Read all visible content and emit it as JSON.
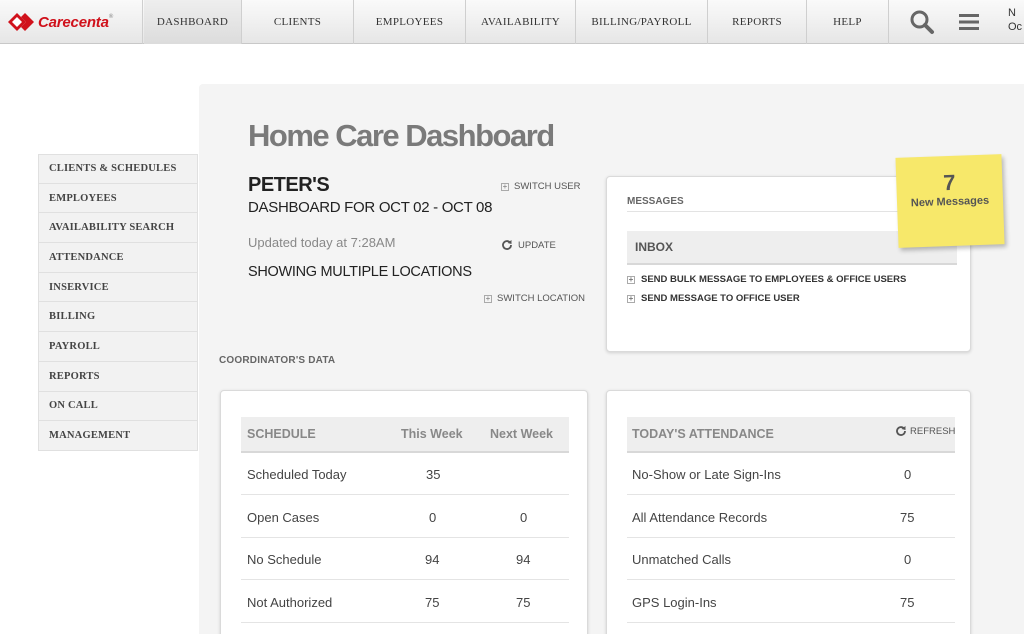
{
  "brand": {
    "name": "Carecenta",
    "reg": "®"
  },
  "nav": {
    "items": [
      "DASHBOARD",
      "CLIENTS",
      "EMPLOYEES",
      "AVAILABILITY",
      "BILLING/PAYROLL",
      "REPORTS",
      "HELP"
    ],
    "active": "DASHBOARD",
    "user_cut_line1": "N",
    "user_cut_line2": "Oc"
  },
  "sidebar": {
    "items": [
      "CLIENTS & SCHEDULES",
      "EMPLOYEES",
      "AVAILABILITY SEARCH",
      "ATTENDANCE",
      "INSERVICE",
      "BILLING",
      "PAYROLL",
      "REPORTS",
      "ON CALL",
      "MANAGEMENT"
    ]
  },
  "header": {
    "title": "Home Care Dashboard",
    "agency": "PETER'S",
    "range": "DASHBOARD FOR OCT 02 - OCT 08",
    "updated": "Updated today at 7:28AM",
    "locations": "SHOWING MULTIPLE LOCATIONS",
    "switch_user": "SWITCH USER",
    "update": "UPDATE",
    "switch_location": "SWITCH LOCATION"
  },
  "messages": {
    "heading": "MESSAGES",
    "inbox": "INBOX",
    "bulk": "SEND BULK MESSAGE TO EMPLOYEES & OFFICE USERS",
    "office": "SEND MESSAGE TO OFFICE USER",
    "note_count": "7",
    "note_label": "New Messages"
  },
  "coordinator_label": "COORDINATOR'S DATA",
  "schedule": {
    "headers": [
      "SCHEDULE",
      "This Week",
      "Next Week"
    ],
    "rows": [
      [
        "Scheduled Today",
        "35",
        ""
      ],
      [
        "Open Cases",
        "0",
        "0"
      ],
      [
        "No Schedule",
        "94",
        "94"
      ],
      [
        "Not Authorized",
        "75",
        "75"
      ]
    ]
  },
  "attendance": {
    "heading": "TODAY'S ATTENDANCE",
    "refresh": "REFRESH",
    "rows": [
      [
        "No-Show or Late Sign-Ins",
        "0"
      ],
      [
        "All Attendance Records",
        "75"
      ],
      [
        "Unmatched Calls",
        "0"
      ],
      [
        "GPS Login-Ins",
        "75"
      ]
    ]
  },
  "colors": {
    "brand_red": "#d0111b",
    "sticky": "#f7e86a"
  }
}
